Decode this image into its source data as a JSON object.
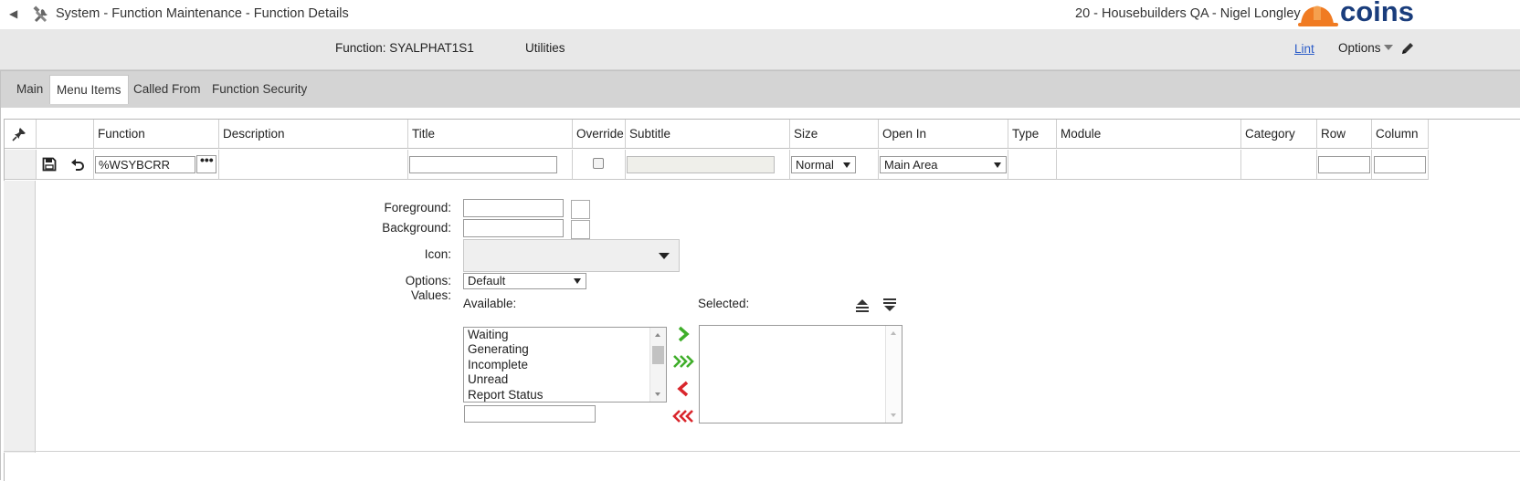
{
  "titlebar": {
    "title": "System - Function Maintenance - Function Details",
    "context": "20 - Housebuilders QA - Nigel Longley",
    "logo_text": "COINS",
    "back_icon": "back-arrow-icon",
    "tools_icon": "tools-icon"
  },
  "header": {
    "function_label": "Function: SYALPHAT1S1",
    "utilities": "Utilities",
    "lint": "Lint",
    "options": "Options"
  },
  "tabs": [
    {
      "label": "Main"
    },
    {
      "label": "Menu Items"
    },
    {
      "label": "Called From"
    },
    {
      "label": "Function Security"
    }
  ],
  "grid": {
    "columns": [
      "Function",
      "Description",
      "Title",
      "Override",
      "Subtitle",
      "Size",
      "Open In",
      "Type",
      "Module",
      "Category",
      "Row",
      "Column"
    ],
    "row": {
      "function": "%WSYBCRR",
      "title": "",
      "override": false,
      "subtitle": "",
      "size": "Normal",
      "open_in": "Main Area",
      "row": "",
      "column": ""
    }
  },
  "detail": {
    "foreground_label": "Foreground:",
    "background_label": "Background:",
    "icon_label": "Icon:",
    "options_label": "Options:",
    "values_label": "Values:",
    "options_value": "Default",
    "available_label": "Available:",
    "selected_label": "Selected:",
    "available_items": [
      "Waiting",
      "Generating",
      "Incomplete",
      "Unread",
      "Report Status"
    ],
    "selected_items": []
  },
  "colors": {
    "accent_green": "#3fae2a",
    "accent_red": "#d9262c",
    "link_blue": "#2b5cc8",
    "logo_blue": "#1a3d7c",
    "logo_orange": "#f07b22"
  }
}
